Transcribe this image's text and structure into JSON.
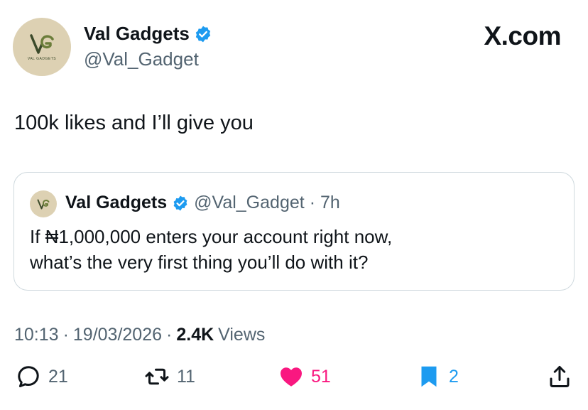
{
  "author": {
    "name": "Val Gadgets",
    "handle": "@Val_Gadget",
    "avatar_caption": "VAL GADGETS"
  },
  "brand": "X.com",
  "tweet": {
    "text": "100k likes and I’ll give you"
  },
  "quote": {
    "name": "Val Gadgets",
    "handle": "@Val_Gadget",
    "separator": "·",
    "time": "7h",
    "text_line1": "If ₦1,000,000 enters your account right now,",
    "text_line2": "what’s the very first thing you’ll do with it?"
  },
  "meta": {
    "time": "10:13",
    "sep1": "·",
    "date": "19/03/2026",
    "sep2": "·",
    "views_count": "2.4K",
    "views_label": "Views"
  },
  "actions": {
    "replies": "21",
    "retweets": "11",
    "likes": "51",
    "bookmarks": "2"
  },
  "colors": {
    "verified": "#1d9bf0",
    "like": "#f91880",
    "bookmark": "#1d9bf0",
    "muted": "#536471",
    "avatar_bg": "#ddd1b3"
  },
  "icons": [
    "verified-badge-icon",
    "reply-icon",
    "retweet-icon",
    "heart-icon",
    "bookmark-icon",
    "share-icon"
  ]
}
